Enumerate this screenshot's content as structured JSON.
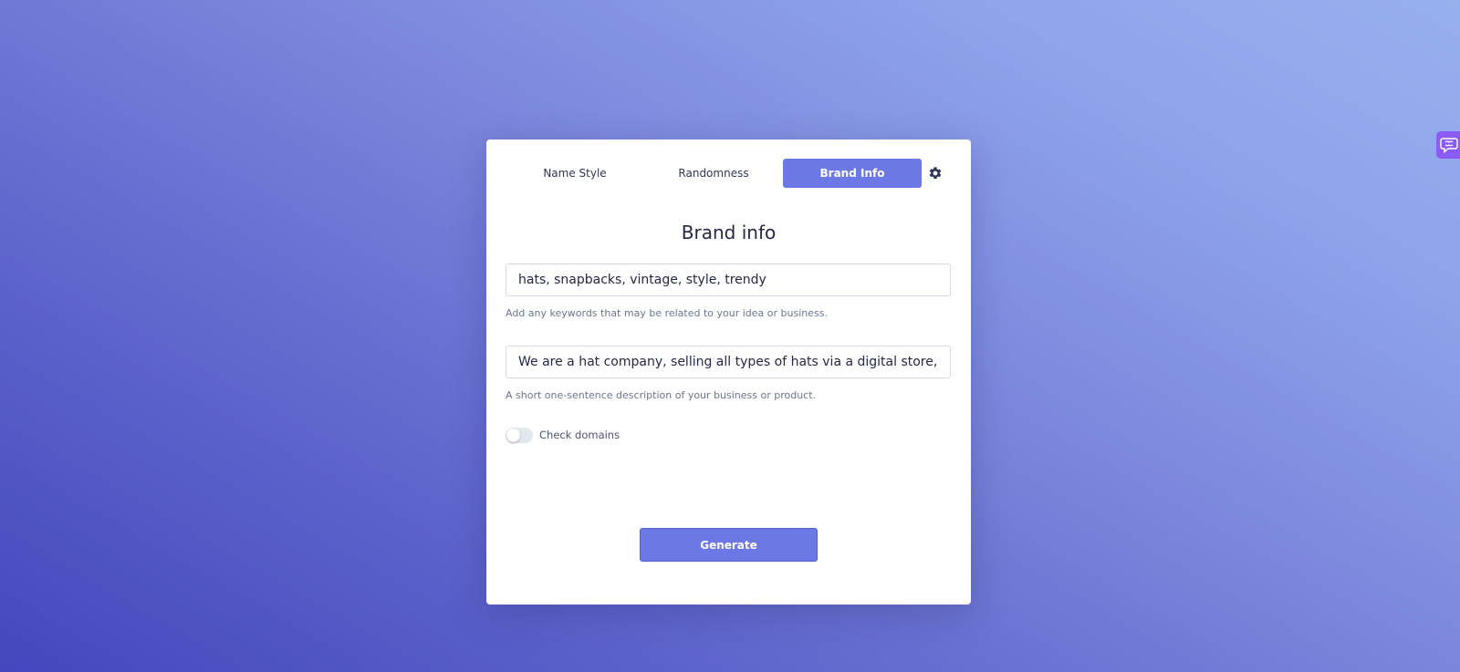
{
  "tabs": [
    {
      "label": "Name Style",
      "active": false
    },
    {
      "label": "Randomness",
      "active": false
    },
    {
      "label": "Brand Info",
      "active": true
    }
  ],
  "settings_icon": "gear-icon",
  "form": {
    "title": "Brand info",
    "keywords_value": "hats, snapbacks, vintage, style, trendy",
    "keywords_hint": "Add any keywords that may be related to your idea or business.",
    "description_value": "We are a hat company, selling all types of hats via a digital store, worldwide.",
    "description_hint": "A short one-sentence description of your business or product.",
    "check_domains_label": "Check domains",
    "check_domains_on": false,
    "generate_label": "Generate"
  },
  "side_widget_icon": "chat-brain-icon",
  "colors": {
    "accent": "#6b78e6",
    "side_widget": "#8a5cf5"
  }
}
